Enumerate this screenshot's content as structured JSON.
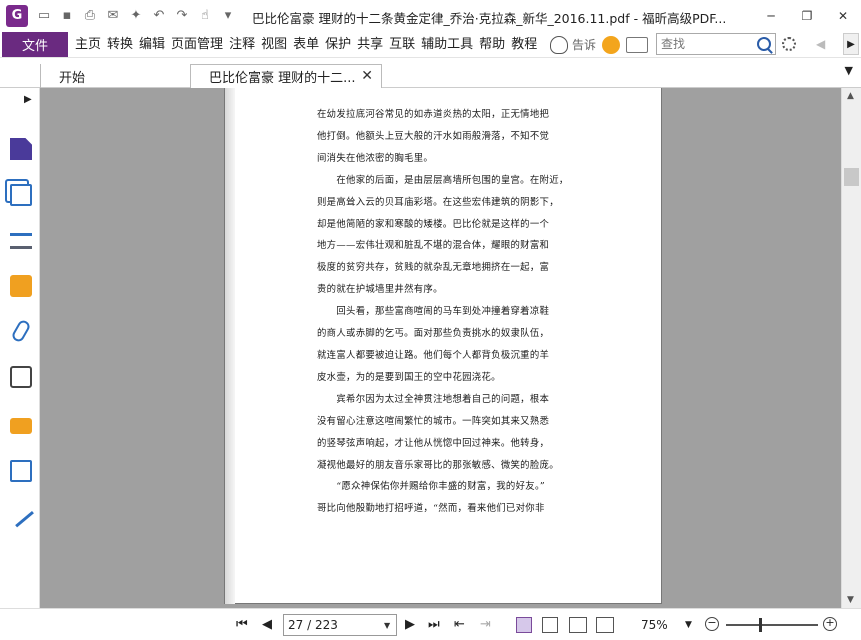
{
  "window": {
    "title": "巴比伦富豪 理财的十二条黄金定律_乔治·克拉森_新华_2016.11.pdf - 福昕高级PDF...",
    "app_logo": "G",
    "controls": [
      "─",
      "❐",
      "✕"
    ]
  },
  "quick_access": [
    "open-icon",
    "save-icon",
    "print-icon",
    "email-icon",
    "new-icon",
    "undo-icon",
    "redo-icon",
    "hand-icon"
  ],
  "menubar": {
    "file": "文件",
    "items": [
      "主页",
      "转换",
      "编辑",
      "页面管理",
      "注释",
      "视图",
      "表单",
      "保护",
      "共享",
      "互联",
      "辅助工具",
      "帮助",
      "教程"
    ],
    "tellme": "告诉",
    "search_placeholder": "查找"
  },
  "tabs": [
    {
      "label": "开始"
    },
    {
      "label": "巴比伦富豪 理财的十二..."
    }
  ],
  "sidebar": [
    "page-thumbnail-icon",
    "pages-icon",
    "layers-icon",
    "comments-icon",
    "attachments-icon",
    "signature-icon",
    "security-icon",
    "form-fields-icon",
    "certificate-icon"
  ],
  "page_text": {
    "lines": [
      "在幼发拉底河谷常见的如赤道炎热的太阳，正无情地把",
      "他打倒。他额头上豆大般的汗水如雨般滑落，不知不觉",
      "间消失在他浓密的胸毛里。",
      "　　在他家的后面，是由层层高墙所包围的皇宫。在附近，",
      "则是高耸入云的贝耳庙彩塔。在这些宏伟建筑的阴影下，",
      "却是他简陋的家和寒酸的矮楼。巴比伦就是这样的一个",
      "地方——宏伟壮观和脏乱不堪的混合体，耀眼的财富和",
      "极度的贫穷共存，贫贱的就杂乱无章地拥挤在一起，富",
      "贵的就在护城墙里井然有序。",
      "　　回头看，那些富商喧闹的马车到处冲撞着穿着凉鞋",
      "的商人或赤脚的乞丐。面对那些负责挑水的奴隶队伍，",
      "就连富人都要被迫让路。他们每个人都背负极沉重的羊",
      "皮水壶，为的是要到国王的空中花园浇花。",
      "　　宾希尔因为太过全神贯注地想着自己的问题，根本",
      "没有留心注意这喧闹繁忙的城市。一阵突如其来又熟悉",
      "的竖琴弦声响起，才让他从恍惚中回过神来。他转身，",
      "凝视他最好的朋友音乐家哥比的那张敏感、微笑的脸庞。",
      "　　“愿众神保佑你并赐给你丰盛的财富，我的好友。”",
      "哥比向他殷勤地打招呼道，“然而，看来他们已对你非"
    ]
  },
  "statusbar": {
    "page_value": "27 / 223",
    "zoom": "75%",
    "zoom_level_fraction": 0.36
  }
}
